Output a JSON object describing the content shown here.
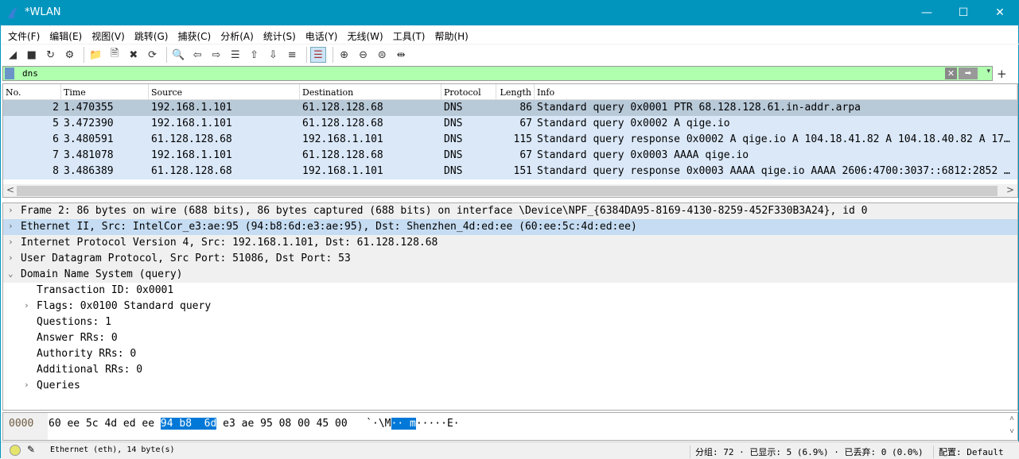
{
  "window": {
    "title": "*WLAN",
    "minimize": "—",
    "maximize": "☐",
    "close": "✕"
  },
  "menu": [
    "文件(F)",
    "编辑(E)",
    "视图(V)",
    "跳转(G)",
    "捕获(C)",
    "分析(A)",
    "统计(S)",
    "电话(Y)",
    "无线(W)",
    "工具(T)",
    "帮助(H)"
  ],
  "toolbar": [
    {
      "icon": "start-capture-icon",
      "glyph": "◢"
    },
    {
      "icon": "stop-capture-icon",
      "glyph": "■"
    },
    {
      "icon": "restart-capture-icon",
      "glyph": "↻"
    },
    {
      "icon": "capture-options-icon",
      "glyph": "⚙"
    },
    {
      "sep": true
    },
    {
      "icon": "open-file-icon",
      "glyph": "📁"
    },
    {
      "icon": "save-file-icon",
      "glyph": "🗎"
    },
    {
      "icon": "close-file-icon",
      "glyph": "✖"
    },
    {
      "icon": "reload-file-icon",
      "glyph": "⟳"
    },
    {
      "sep": true
    },
    {
      "icon": "find-packet-icon",
      "glyph": "🔍"
    },
    {
      "icon": "go-back-icon",
      "glyph": "⇦"
    },
    {
      "icon": "go-forward-icon",
      "glyph": "⇨"
    },
    {
      "icon": "go-to-packet-icon",
      "glyph": "☰"
    },
    {
      "icon": "go-first-icon",
      "glyph": "⇧"
    },
    {
      "icon": "go-last-icon",
      "glyph": "⇩"
    },
    {
      "icon": "auto-scroll-icon",
      "glyph": "≡"
    },
    {
      "sep": true
    },
    {
      "icon": "colorize-icon",
      "glyph": "☰",
      "active": true
    },
    {
      "sep": true
    },
    {
      "icon": "zoom-in-icon",
      "glyph": "⊕"
    },
    {
      "icon": "zoom-out-icon",
      "glyph": "⊖"
    },
    {
      "icon": "zoom-normal-icon",
      "glyph": "⊜"
    },
    {
      "icon": "resize-columns-icon",
      "glyph": "⇹"
    }
  ],
  "filter": {
    "value": "dns",
    "clear": "✕",
    "apply": "➡",
    "dropdown": "▾",
    "add": "+"
  },
  "packet_list": {
    "columns": [
      "No.",
      "Time",
      "Source",
      "Destination",
      "Protocol",
      "Length",
      "Info"
    ],
    "rows": [
      [
        "2",
        "1.470355",
        "192.168.1.101",
        "61.128.128.68",
        "DNS",
        "86",
        "Standard query 0x0001 PTR 68.128.128.61.in-addr.arpa"
      ],
      [
        "5",
        "3.472390",
        "192.168.1.101",
        "61.128.128.68",
        "DNS",
        "67",
        "Standard query 0x0002 A qige.io"
      ],
      [
        "6",
        "3.480591",
        "61.128.128.68",
        "192.168.1.101",
        "DNS",
        "115",
        "Standard query response 0x0002 A qige.io A 104.18.41.82 A 104.18.40.82 A 17…"
      ],
      [
        "7",
        "3.481078",
        "192.168.1.101",
        "61.128.128.68",
        "DNS",
        "67",
        "Standard query 0x0003 AAAA qige.io"
      ],
      [
        "8",
        "3.486389",
        "61.128.128.68",
        "192.168.1.101",
        "DNS",
        "151",
        "Standard query response 0x0003 AAAA qige.io AAAA 2606:4700:3037::6812:2852 …"
      ]
    ],
    "selected_row": 0,
    "scroll_left": "<",
    "scroll_right": ">"
  },
  "details": [
    {
      "text": "Frame 2: 86 bytes on wire (688 bits), 86 bytes captured (688 bits) on interface \\Device\\NPF_{6384DA95-8169-4130-8259-452F330B3A24}, id 0",
      "level": 0,
      "expander": "›"
    },
    {
      "text": "Ethernet II, Src: IntelCor_e3:ae:95 (94:b8:6d:e3:ae:95), Dst: Shenzhen_4d:ed:ee (60:ee:5c:4d:ed:ee)",
      "level": 0,
      "expander": "›",
      "highlight": true
    },
    {
      "text": "Internet Protocol Version 4, Src: 192.168.1.101, Dst: 61.128.128.68",
      "level": 0,
      "expander": "›"
    },
    {
      "text": "User Datagram Protocol, Src Port: 51086, Dst Port: 53",
      "level": 0,
      "expander": "›"
    },
    {
      "text": "Domain Name System (query)",
      "level": 0,
      "expander": "⌄"
    },
    {
      "text": "Transaction ID: 0x0001",
      "level": 1,
      "expander": ""
    },
    {
      "text": "Flags: 0x0100 Standard query",
      "level": 1,
      "expander": "›"
    },
    {
      "text": "Questions: 1",
      "level": 1,
      "expander": ""
    },
    {
      "text": "Answer RRs: 0",
      "level": 1,
      "expander": ""
    },
    {
      "text": "Authority RRs: 0",
      "level": 1,
      "expander": ""
    },
    {
      "text": "Additional RRs: 0",
      "level": 1,
      "expander": ""
    },
    {
      "text": "Queries",
      "level": 1,
      "expander": "›"
    }
  ],
  "hex": {
    "offset": "0000",
    "bytes_pre": "60 ee 5c 4d ed ee ",
    "bytes_hl": "94 b8  6d",
    "bytes_post": " e3 ae 95 08 00 45 00",
    "ascii_pre": "`·\\M",
    "ascii_hl": "·· m",
    "ascii_post": "·····E·",
    "scroll_up": "˄",
    "scroll_down": "˅"
  },
  "status": {
    "field": "Ethernet (eth), 14 byte(s)",
    "packets": "分组: 72 · 已显示: 5 (6.9%) · 已丢弃: 0 (0.0%)",
    "profile": "配置: Default"
  }
}
